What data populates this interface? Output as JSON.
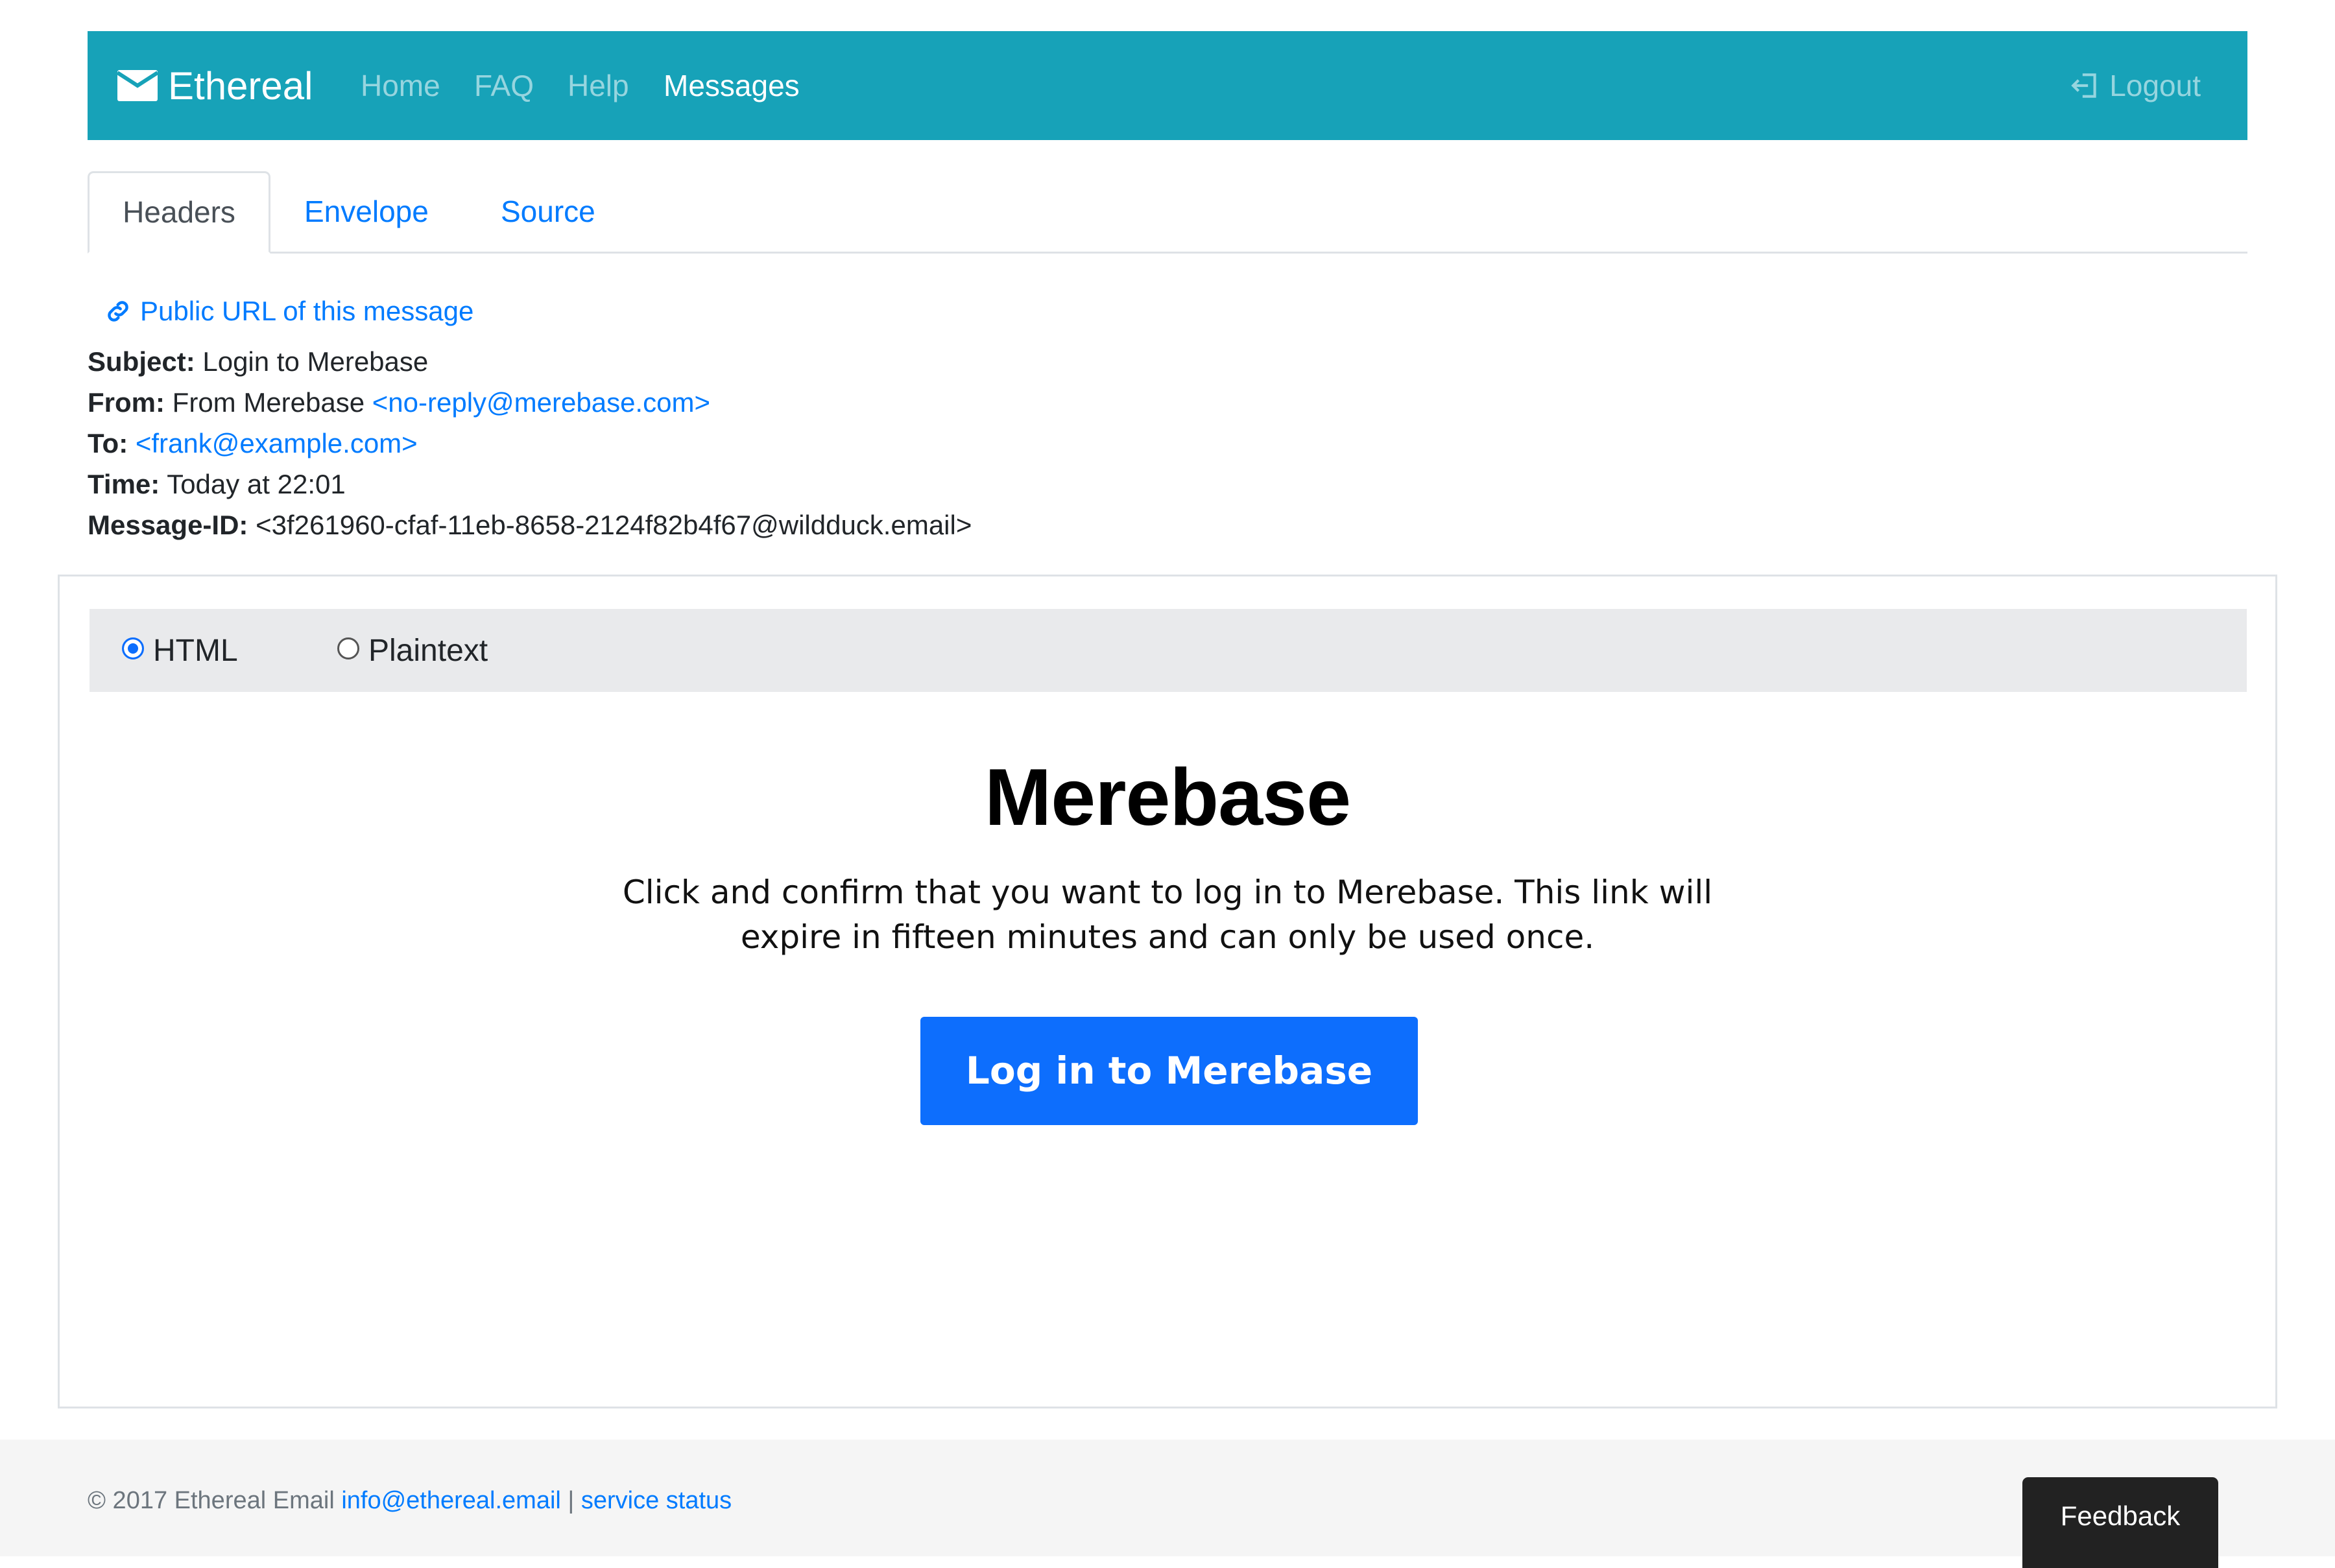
{
  "navbar": {
    "brand": "Ethereal",
    "items": [
      {
        "label": "Home"
      },
      {
        "label": "FAQ"
      },
      {
        "label": "Help"
      },
      {
        "label": "Messages",
        "active": true
      }
    ],
    "logout_label": "Logout",
    "bg_color": "#17a2b8"
  },
  "tabs": [
    {
      "label": "Headers",
      "active": true
    },
    {
      "label": "Envelope"
    },
    {
      "label": "Source"
    }
  ],
  "headers": {
    "public_url_label": "Public URL of this message",
    "subject_label": "Subject:",
    "subject": "Login to Merebase",
    "from_label": "From:",
    "from_name": "From Merebase",
    "from_email": "<no-reply@merebase.com>",
    "to_label": "To:",
    "to_email": "<frank@example.com>",
    "time_label": "Time:",
    "time": "Today at 22:01",
    "message_id_label": "Message-ID:",
    "message_id": "<3f261960-cfaf-11eb-8658-2124f82b4f67@wildduck.email>"
  },
  "format": {
    "options": [
      "HTML",
      "Plaintext"
    ],
    "selected": "HTML"
  },
  "email": {
    "title": "Merebase",
    "body": "Click and confirm that you want to log in to Merebase. This link will expire in fifteen minutes and can only be used once.",
    "button_label": "Log in to Merebase",
    "button_color": "#0d6efd"
  },
  "footer": {
    "copyright": "© 2017 Ethereal Email",
    "email": "info@ethereal.email",
    "separator": "|",
    "status_link": "service status",
    "feedback_label": "Feedback"
  }
}
